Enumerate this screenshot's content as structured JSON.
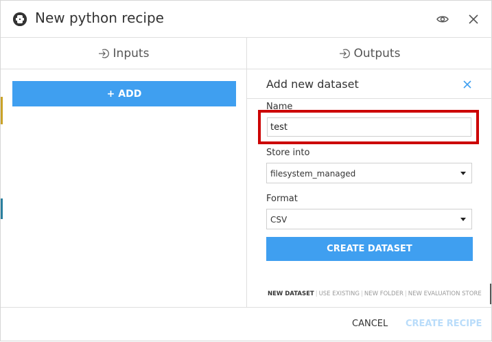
{
  "dialog": {
    "title": "New python recipe"
  },
  "inputs": {
    "header": "Inputs",
    "add_button": "+ ADD"
  },
  "outputs": {
    "header": "Outputs",
    "panel_title": "Add new dataset",
    "name_label": "Name",
    "name_value": "test",
    "store_label": "Store into",
    "store_value": "filesystem_managed",
    "format_label": "Format",
    "format_value": "CSV",
    "create_button": "CREATE DATASET",
    "tabs": [
      "NEW DATASET",
      "USE EXISTING",
      "NEW FOLDER",
      "NEW EVALUATION STORE"
    ],
    "active_tab": "NEW DATASET"
  },
  "footer": {
    "cancel": "CANCEL",
    "create_recipe": "CREATE RECIPE"
  },
  "colors": {
    "accent": "#3f9ff0",
    "highlight": "#cc0000",
    "disabled_text": "#b9dcfa"
  },
  "icons": {
    "recipe": "python-recipe-icon",
    "preview": "eye-icon",
    "close": "close-icon",
    "inputs": "sign-in-icon",
    "outputs": "sign-out-icon",
    "panel_close": "close-icon",
    "dropdown": "caret-down-icon"
  }
}
